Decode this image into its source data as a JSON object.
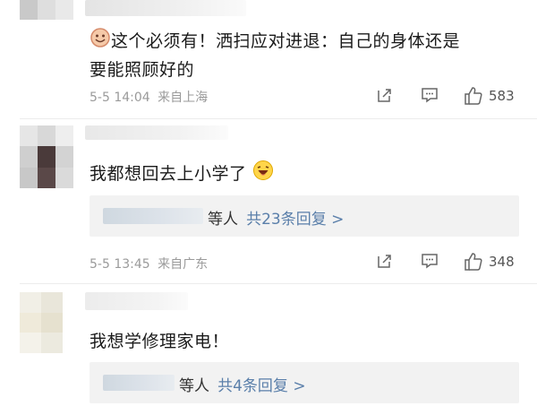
{
  "comments": [
    {
      "text": "这个必须有！洒扫应对进退：自己的身体还是要能照顾好的",
      "line1": "这个必须有！洒扫应对进退：自己的身体还是",
      "line2": "要能照顾好的",
      "time": "5-5 14:04",
      "location": "来自上海",
      "likes": "583"
    },
    {
      "text": "我都想回去上小学了",
      "reply_suffix": "等人",
      "reply_link": "共23条回复 >",
      "time": "5-5 13:45",
      "location": "来自广东",
      "likes": "348"
    },
    {
      "text": "我想学修理家电！",
      "reply_suffix": "等人",
      "reply_link": "共4条回复 >"
    }
  ],
  "icons": {
    "share": "share-icon",
    "comment": "comment-icon",
    "like": "thumbs-up-icon"
  },
  "colors": {
    "link": "#5a7faa",
    "meta": "#9a9a9a",
    "reply_bg": "#f2f2f2"
  }
}
